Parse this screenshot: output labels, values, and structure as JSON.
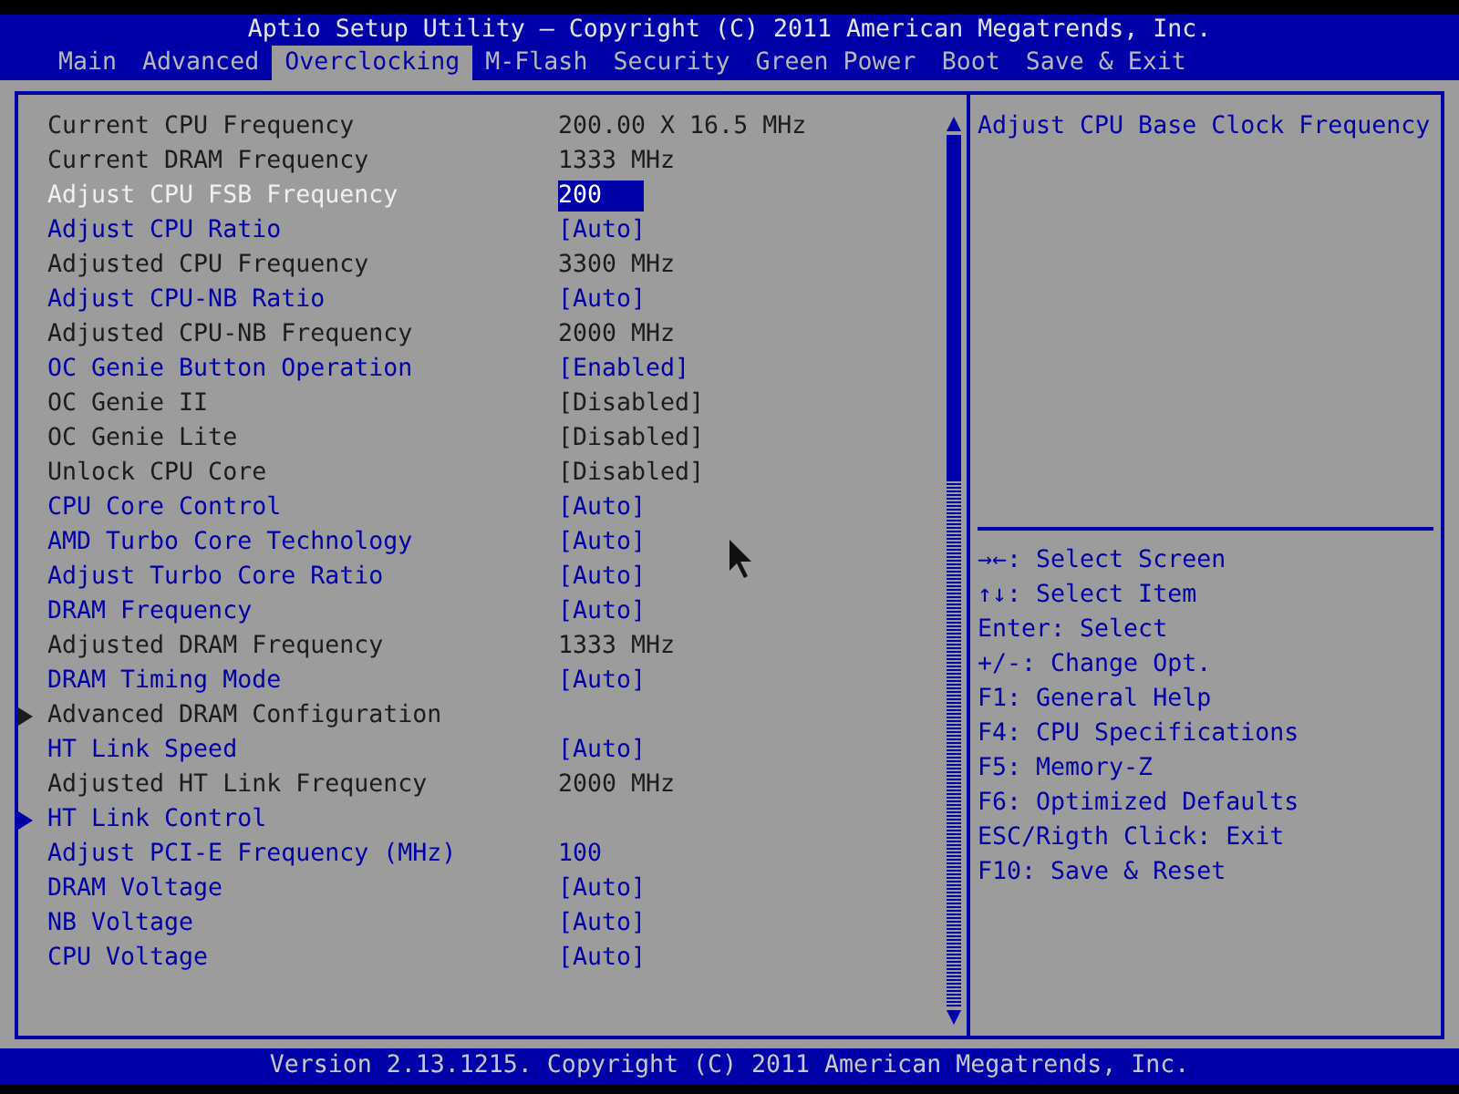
{
  "header": {
    "title": "Aptio Setup Utility – Copyright (C) 2011 American Megatrends, Inc."
  },
  "tabs": [
    {
      "label": "Main",
      "selected": false
    },
    {
      "label": "Advanced",
      "selected": false
    },
    {
      "label": "Overclocking",
      "selected": true
    },
    {
      "label": "M-Flash",
      "selected": false
    },
    {
      "label": "Security",
      "selected": false
    },
    {
      "label": "Green Power",
      "selected": false
    },
    {
      "label": "Boot",
      "selected": false
    },
    {
      "label": "Save & Exit",
      "selected": false
    }
  ],
  "settings": [
    {
      "kind": "info",
      "label": "Current CPU Frequency",
      "value": "200.00 X 16.5 MHz",
      "selected": false
    },
    {
      "kind": "info",
      "label": "Current DRAM Frequency",
      "value": "1333 MHz",
      "selected": false
    },
    {
      "kind": "option",
      "label": "Adjust CPU FSB Frequency",
      "value": "200",
      "selected": true
    },
    {
      "kind": "option",
      "label": "Adjust CPU Ratio",
      "value": "[Auto]",
      "selected": false
    },
    {
      "kind": "info",
      "label": "Adjusted CPU Frequency",
      "value": "3300 MHz",
      "selected": false
    },
    {
      "kind": "option",
      "label": "Adjust CPU-NB Ratio",
      "value": "[Auto]",
      "selected": false
    },
    {
      "kind": "info",
      "label": "Adjusted CPU-NB Frequency",
      "value": "2000 MHz",
      "selected": false
    },
    {
      "kind": "option",
      "label": "OC Genie Button Operation",
      "value": "[Enabled]",
      "selected": false
    },
    {
      "kind": "info",
      "label": "OC Genie II",
      "value": "[Disabled]",
      "selected": false
    },
    {
      "kind": "info",
      "label": "OC Genie Lite",
      "value": "[Disabled]",
      "selected": false
    },
    {
      "kind": "info",
      "label": "Unlock CPU Core",
      "value": "[Disabled]",
      "selected": false
    },
    {
      "kind": "option",
      "label": "CPU Core Control",
      "value": "[Auto]",
      "selected": false
    },
    {
      "kind": "option",
      "label": "AMD Turbo Core Technology",
      "value": "[Auto]",
      "selected": false
    },
    {
      "kind": "option",
      "label": "Adjust Turbo Core Ratio",
      "value": "[Auto]",
      "selected": false
    },
    {
      "kind": "option",
      "label": "DRAM Frequency",
      "value": "[Auto]",
      "selected": false
    },
    {
      "kind": "info",
      "label": "Adjusted DRAM Frequency",
      "value": "1333 MHz",
      "selected": false
    },
    {
      "kind": "option",
      "label": "DRAM Timing Mode",
      "value": "[Auto]",
      "selected": false
    },
    {
      "kind": "info_submenu",
      "label": "Advanced DRAM Configuration",
      "selected": false
    },
    {
      "kind": "option",
      "label": "HT Link Speed",
      "value": "[Auto]",
      "selected": false
    },
    {
      "kind": "info",
      "label": "Adjusted HT Link Frequency",
      "value": "2000 MHz",
      "selected": false
    },
    {
      "kind": "option_submenu",
      "label": "HT Link Control",
      "selected": false
    },
    {
      "kind": "option",
      "label": "Adjust PCI-E Frequency (MHz)",
      "value": "100",
      "selected": false
    },
    {
      "kind": "option",
      "label": "DRAM Voltage",
      "value": "[Auto]",
      "selected": false
    },
    {
      "kind": "option",
      "label": "NB Voltage",
      "value": "[Auto]",
      "selected": false
    },
    {
      "kind": "option",
      "label": "CPU Voltage",
      "value": "[Auto]",
      "selected": false
    }
  ],
  "help": {
    "text": "Adjust CPU Base Clock Frequency"
  },
  "key_hints": [
    "→←: Select Screen",
    "↑↓: Select Item",
    "Enter: Select",
    "+/-: Change Opt.",
    "F1: General Help",
    "F4: CPU Specifications",
    "F5: Memory-Z",
    "F6: Optimized Defaults",
    "ESC/Rigth Click: Exit",
    "F10: Save & Reset"
  ],
  "footer": {
    "text": "Version 2.13.1215. Copyright (C) 2011 American Megatrends, Inc."
  }
}
